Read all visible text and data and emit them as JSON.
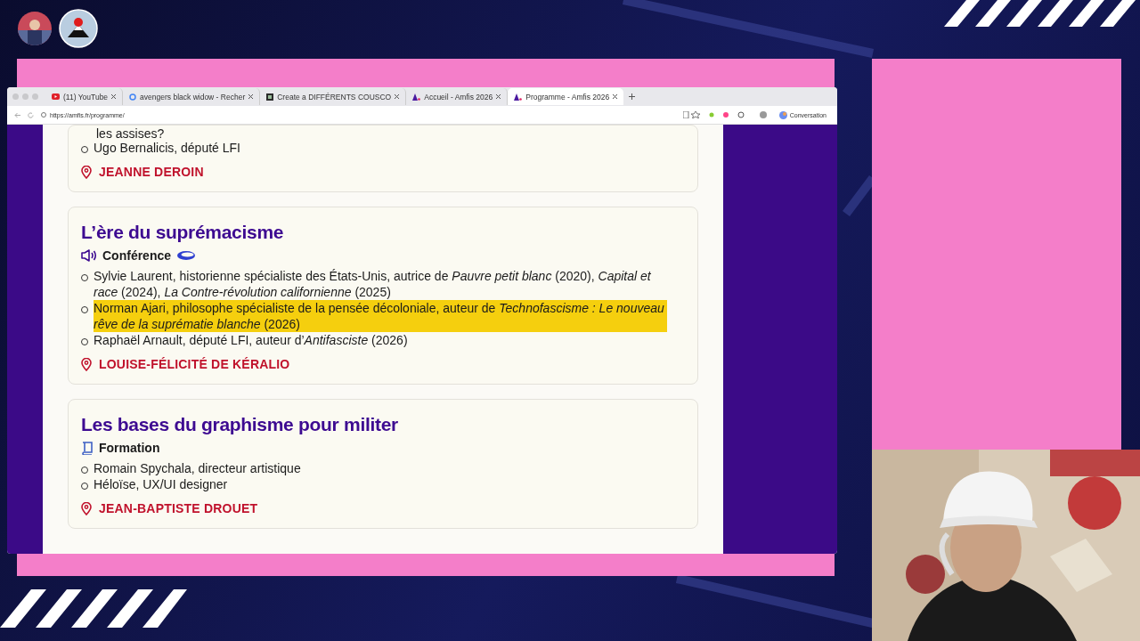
{
  "browser": {
    "tabs": [
      {
        "title": "(11) YouTube",
        "kind": "youtube",
        "selected": false
      },
      {
        "title": "avengers black widow - Recher",
        "kind": "google",
        "selected": false
      },
      {
        "title": "Create a DIFFÉRENTS COUSCO",
        "kind": "doc",
        "selected": false
      },
      {
        "title": "Accueil - Amfis 2026",
        "kind": "amfis",
        "selected": false
      },
      {
        "title": "Programme - Amfis 2026",
        "kind": "amfis",
        "selected": true
      }
    ],
    "address": "https://amfis.fr/programme/",
    "assistant_button": "Conversation"
  },
  "sessions": [
    {
      "fragment": "les assises?",
      "speakers": [
        {
          "text": "Ugo Bernalicis, député LFI",
          "highlighted": false
        }
      ],
      "location": "JEANNE DEROIN"
    },
    {
      "title": "L’ère du suprémacisme",
      "kind": "conference",
      "kind_label": "Conférence",
      "speakers": [
        {
          "text": "Sylvie Laurent, historienne spécialiste des États-Unis, autrice de *Pauvre petit blanc* (2020), *Capital et race* (2024), *La Contre-révolution californienne* (2025)",
          "highlighted": false
        },
        {
          "text": "Norman Ajari, philosophe spécialiste de la pensée décoloniale, auteur de *Technofascisme : Le nouveau rêve de la suprématie blanche* (2026)",
          "highlighted": true
        },
        {
          "text": "Raphaël Arnault, député LFI, auteur d’*Antifasciste* (2026)",
          "highlighted": false
        }
      ],
      "location": "LOUISE-FÉLICITÉ DE KÉRALIO"
    },
    {
      "title": "Les bases du graphisme pour militer",
      "kind": "training",
      "kind_label": "Formation",
      "speakers": [
        {
          "text": "Romain Spychala, directeur artistique",
          "highlighted": false
        },
        {
          "text": "Héloïse, UX/UI designer",
          "highlighted": false
        }
      ],
      "location": "JEAN-BAPTISTE DROUET"
    }
  ]
}
